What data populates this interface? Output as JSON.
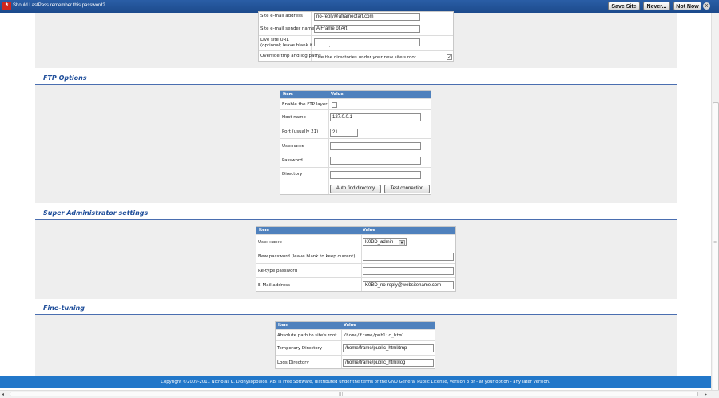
{
  "lastpass_bar": {
    "message": "Should LastPass remember this password?",
    "save_label": "Save Site",
    "never_label": "Never...",
    "notnow_label": "Not Now",
    "close_glyph": "x"
  },
  "site_settings": {
    "rows": [
      {
        "label": "Site e-mail address",
        "value": "no-reply@aframeofart.com"
      },
      {
        "label": "Site e-mail sender name",
        "value": "A Frame of Art"
      },
      {
        "label": "Live site URL",
        "sublabel": "(optional; leave blank if unsure)",
        "value": ""
      },
      {
        "label": "Override tmp and log paths.",
        "value": "Use the directories under your new site's root",
        "checked": true
      }
    ]
  },
  "ftp": {
    "title": "FTP Options",
    "header_item": "Item",
    "header_value": "Value",
    "enable_label": "Enable the FTP layer",
    "enable_checked": false,
    "host_label": "Host name",
    "host_value": "127.0.0.1",
    "port_label": "Port (usually 21)",
    "port_value": "21",
    "username_label": "Username",
    "username_value": "",
    "password_label": "Password",
    "password_value": "",
    "directory_label": "Directory",
    "directory_value": "",
    "auto_find_label": "Auto find directory",
    "test_label": "Test connection"
  },
  "super_admin": {
    "title": "Super Administrator settings",
    "header_item": "Item",
    "header_value": "Value",
    "username_label": "User name",
    "username_value": "K0BD_admin",
    "newpass_label": "New password (leave blank to keep current)",
    "newpass_value": "",
    "retype_label": "Re-type password",
    "retype_value": "",
    "email_label": "E-Mail address",
    "email_value": "K0BD_no-reply@websitename.com"
  },
  "fine_tuning": {
    "title": "Fine-tuning",
    "header_item": "Item",
    "header_value": "Value",
    "abs_path_label": "Absolute path to site's root",
    "abs_path_value": "/home/frame/public_html",
    "tmp_label": "Temporary Directory",
    "tmp_value": "/home/frame/public_html/tmp",
    "logs_label": "Logs Directory",
    "logs_value": "/home/frame/public_html/log"
  },
  "footer": {
    "text": "Copyright ©2009-2011 Nicholas K. Dionysopoulos. ABI is Free Software, distributed under the terms of the GNU General Public License, version 3 or - at your option - any later version."
  },
  "colors": {
    "accent": "#1f4e9a",
    "table_header": "#4f81bd",
    "footer": "#2277c9",
    "lastpass_bar": "#1c4a8c",
    "panel_bg": "#eeeeee"
  }
}
